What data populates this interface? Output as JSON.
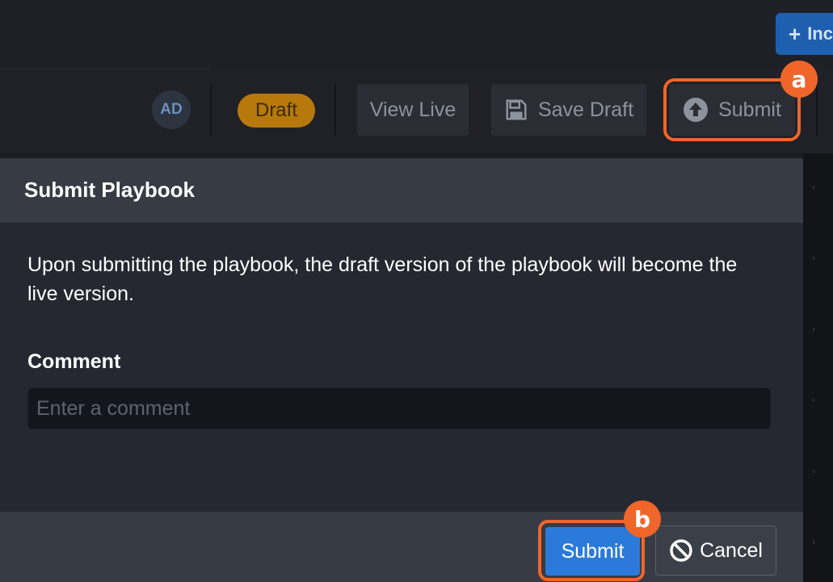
{
  "header": {
    "new_button_label": "Inc",
    "avatar_initials": "AD",
    "status_badge": "Draft",
    "view_live_label": "View Live",
    "save_draft_label": "Save Draft",
    "submit_label": "Submit"
  },
  "dialog": {
    "title": "Submit Playbook",
    "message": "Upon submitting the playbook, the draft version of the playbook will become the live version.",
    "comment_label": "Comment",
    "comment_placeholder": "Enter a comment",
    "comment_value": "",
    "submit_label": "Submit",
    "cancel_label": "Cancel"
  },
  "callouts": {
    "a": "a",
    "b": "b"
  },
  "colors": {
    "accent_orange": "#f0652a",
    "primary_blue": "#2b7ad9",
    "draft_badge": "#b7790b"
  },
  "icons": {
    "new_button": "plus-icon",
    "save_draft": "floppy-disk-icon",
    "submit": "upload-arrow-icon",
    "cancel": "ban-icon"
  }
}
